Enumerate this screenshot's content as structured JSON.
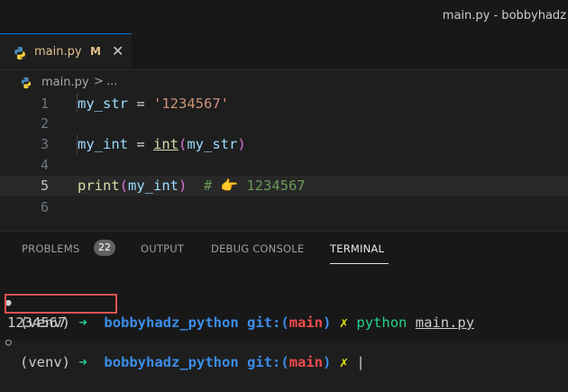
{
  "window": {
    "title": "main.py - bobbyhadz"
  },
  "tab": {
    "filename": "main.py",
    "modified_flag": "M",
    "close_glyph": "✕"
  },
  "breadcrumb": {
    "file": "main.py",
    "separator": ">",
    "more": "..."
  },
  "editor": {
    "current_line": 5,
    "lines": [
      {
        "number": "1",
        "code": "my_str = '1234567'"
      },
      {
        "number": "2",
        "code": ""
      },
      {
        "number": "3",
        "code": "my_int = int(my_str)"
      },
      {
        "number": "4",
        "code": ""
      },
      {
        "number": "5",
        "code": "print(my_int)  # 👉 1234567"
      },
      {
        "number": "6",
        "code": ""
      }
    ],
    "tokens": {
      "l1": {
        "var": "my_str",
        "eq": " = ",
        "str": "'1234567'"
      },
      "l3": {
        "var": "my_int",
        "eq": " = ",
        "fn": "int",
        "open": "(",
        "arg": "my_str",
        "close": ")"
      },
      "l5": {
        "fn": "print",
        "open": "(",
        "arg": "my_int",
        "close": ")",
        "comment": "  # 👉 1234567"
      }
    }
  },
  "panel": {
    "tabs": [
      {
        "label": "PROBLEMS",
        "badge": "22"
      },
      {
        "label": "OUTPUT"
      },
      {
        "label": "DEBUG CONSOLE"
      },
      {
        "label": "TERMINAL",
        "active": true
      }
    ]
  },
  "terminal": {
    "lines": [
      {
        "venv": "(venv)",
        "arrow": "➜",
        "dir": "bobbyhadz_python",
        "git": "git:(",
        "branch": "main",
        "git_close": ")",
        "x": "✗",
        "cmd": "python",
        "arg": "main.py"
      },
      {
        "output": "1234567"
      },
      {
        "venv": "(venv)",
        "arrow": "➜",
        "dir": "bobbyhadz_python",
        "git": "git:(",
        "branch": "main",
        "git_close": ")",
        "x": "✗",
        "cursor": "|"
      }
    ]
  },
  "colors": {
    "accent": "#0078d4",
    "highlight_box": "#e05252",
    "modified": "#e2c08d"
  }
}
